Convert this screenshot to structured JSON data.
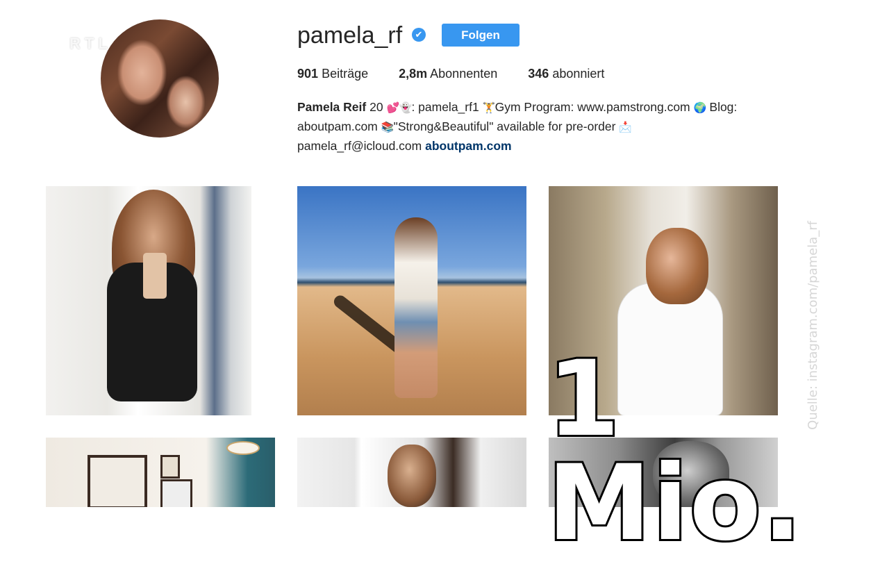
{
  "tv_logo": "RTL HD",
  "profile": {
    "username": "pamela_rf",
    "verified_glyph": "✔",
    "follow_label": "Folgen",
    "stats": [
      {
        "value": "901",
        "label": "Beiträge"
      },
      {
        "value": "2,8m",
        "label": "Abonnenten"
      },
      {
        "value": "346",
        "label": "abonniert"
      }
    ],
    "bio": {
      "name": "Pamela Reif",
      "age": "20",
      "part1": ": pamela_rf1",
      "gym": "Gym Program: www.pamstrong.com",
      "blog_label": "Blog:",
      "blog_url": "aboutpam.com",
      "book": "\"Strong&Beautiful\" available for pre-order",
      "email": "pamela_rf@icloud.com",
      "link": "aboutpam.com"
    }
  },
  "overlay": {
    "text": "1 Mio.",
    "credit": "Quelle: instagram.com/pamela_rf"
  },
  "icons": {
    "hearts": "💕",
    "ghost": "👻",
    "gym": "🏋",
    "globe": "🌍",
    "books": "📚",
    "mail": "📩"
  }
}
